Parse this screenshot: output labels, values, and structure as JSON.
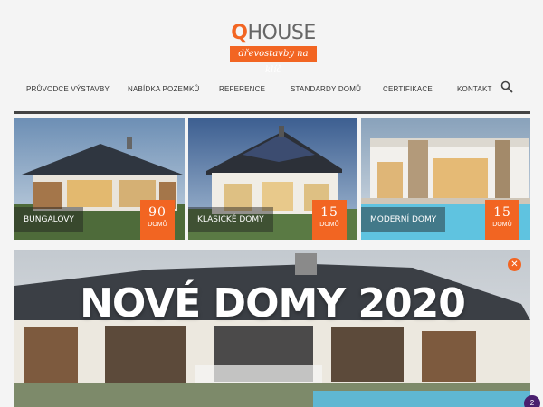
{
  "brand": {
    "logo_q": "Q",
    "logo_rest": "HOUSE",
    "tagline": "dřevostavby na klíč",
    "accent": "#f26522"
  },
  "nav": {
    "items": [
      {
        "label": "Průvodce výstavby"
      },
      {
        "label": "Nabídka pozemků"
      },
      {
        "label": "Reference"
      },
      {
        "label": "Standardy domů"
      },
      {
        "label": "Certifikace"
      },
      {
        "label": "Kontakt"
      }
    ],
    "search_icon": "search-icon"
  },
  "categories": [
    {
      "label": "Bungalovy",
      "count": "90",
      "unit": "domů"
    },
    {
      "label": "Klasické domy",
      "count": "15",
      "unit": "domů"
    },
    {
      "label": "Moderní domy",
      "count": "15",
      "unit": "domů"
    }
  ],
  "banner": {
    "title": "NOVÉ DOMY 2020",
    "close_icon": "close-icon"
  },
  "badge": {
    "count": "2"
  }
}
